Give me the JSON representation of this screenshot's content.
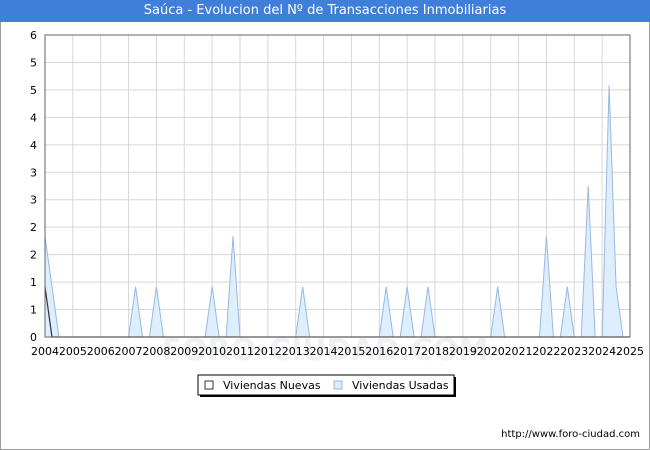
{
  "title": "Saúca - Evolucion del Nº de Transacciones Inmobiliarias",
  "url": "http://www.foro-ciudad.com",
  "watermark": "FORO-CIUDAD.COM",
  "colors": {
    "title_bg": "#3f7fd9",
    "usadas_fill": "#ddeeff",
    "usadas_stroke": "#99b8e0",
    "nuevas_fill": "#ffffff",
    "nuevas_stroke": "#333333",
    "grid": "#d7d7d7"
  },
  "chart_data": {
    "type": "area",
    "title": "Saúca - Evolucion del Nº de Transacciones Inmobiliarias",
    "xlabel": "",
    "ylabel": "",
    "xlim": [
      2004,
      2025
    ],
    "ylim": [
      0,
      6
    ],
    "x_ticks": [
      2004,
      2005,
      2006,
      2007,
      2008,
      2009,
      2010,
      2011,
      2012,
      2013,
      2014,
      2015,
      2016,
      2017,
      2018,
      2019,
      2020,
      2021,
      2022,
      2023,
      2024,
      2025
    ],
    "y_tick_labels": [
      "0",
      "1",
      "1",
      "2",
      "2",
      "3",
      "3",
      "4",
      "4",
      "5",
      "5",
      "6"
    ],
    "grid": true,
    "legend_position": "bottom-center",
    "series": [
      {
        "name": "Viviendas Nuevas",
        "color": "#333333",
        "points": [
          [
            2004.0,
            1
          ],
          [
            2004.25,
            0
          ],
          [
            2025.0,
            0
          ]
        ]
      },
      {
        "name": "Viviendas Usadas",
        "color": "#99b8e0",
        "points": [
          [
            2004.0,
            2
          ],
          [
            2004.5,
            0
          ],
          [
            2007.0,
            0
          ],
          [
            2007.25,
            1
          ],
          [
            2007.5,
            0
          ],
          [
            2007.75,
            0
          ],
          [
            2008.0,
            1
          ],
          [
            2008.25,
            0
          ],
          [
            2009.75,
            0
          ],
          [
            2010.0,
            1
          ],
          [
            2010.25,
            0
          ],
          [
            2010.5,
            0
          ],
          [
            2010.75,
            2
          ],
          [
            2011.0,
            0
          ],
          [
            2013.0,
            0
          ],
          [
            2013.25,
            1
          ],
          [
            2013.5,
            0
          ],
          [
            2016.0,
            0
          ],
          [
            2016.25,
            1
          ],
          [
            2016.5,
            0
          ],
          [
            2016.75,
            0
          ],
          [
            2017.0,
            1
          ],
          [
            2017.25,
            0
          ],
          [
            2017.5,
            0
          ],
          [
            2017.75,
            1
          ],
          [
            2018.0,
            0
          ],
          [
            2020.0,
            0
          ],
          [
            2020.25,
            1
          ],
          [
            2020.5,
            0
          ],
          [
            2021.75,
            0
          ],
          [
            2022.0,
            2
          ],
          [
            2022.25,
            0
          ],
          [
            2022.5,
            0
          ],
          [
            2022.75,
            1
          ],
          [
            2023.0,
            0
          ],
          [
            2023.25,
            0
          ],
          [
            2023.5,
            3
          ],
          [
            2023.75,
            0
          ],
          [
            2024.0,
            0
          ],
          [
            2024.25,
            5
          ],
          [
            2024.5,
            1
          ],
          [
            2024.75,
            0
          ]
        ]
      }
    ]
  }
}
